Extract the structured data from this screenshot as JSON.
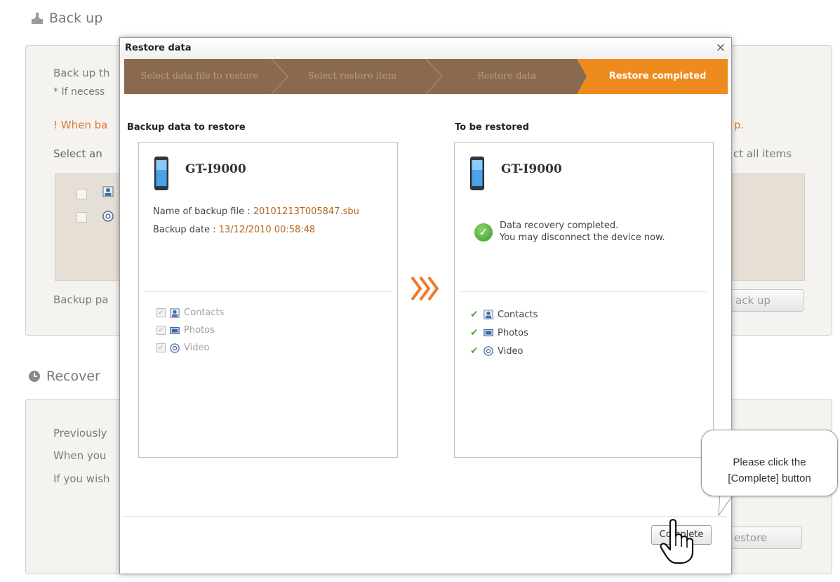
{
  "background": {
    "backup": {
      "title": "Back up",
      "lines": [
        "Back up th",
        "* If necess"
      ],
      "warning": "! When ba",
      "warning_tail": "p.",
      "select_label": "Select an",
      "select_all_tail": "ct all items",
      "path_label": "Backup pa",
      "button": "ack up"
    },
    "recover": {
      "title": "Recover",
      "lines": [
        "Previously",
        "When you",
        "If you wish"
      ],
      "button": "estore"
    }
  },
  "dialog": {
    "title": "Restore data",
    "close": "×",
    "steps": [
      "Select data file to restore",
      "Select restore item",
      "Restore data",
      "Restore completed"
    ],
    "active_step": 3,
    "left": {
      "label": "Backup data to restore",
      "model": "GT-I9000",
      "file_label": "Name of backup file : ",
      "file_value": "20101213T005847.sbu",
      "date_label": "Backup date : ",
      "date_value": "13/12/2010 00:58:48",
      "items": [
        "Contacts",
        "Photos",
        "Video"
      ]
    },
    "right": {
      "label": "To be restored",
      "model": "GT-I9000",
      "status_line1": "Data recovery completed.",
      "status_line2": "You may disconnect the device now.",
      "items": [
        "Contacts",
        "Photos",
        "Video"
      ]
    },
    "complete_button": "Complete"
  },
  "callout": {
    "line1": "Please click the",
    "line2": "[Complete] button"
  },
  "colors": {
    "step_bar": "#8a6a4e",
    "step_active": "#ee8b1f",
    "accent_orange": "#e07a2a",
    "value_brown": "#b5651d",
    "check_green": "#5aa63a"
  },
  "icons": [
    "download-icon",
    "clock-icon",
    "phone-icon",
    "contacts-icon",
    "photos-icon",
    "video-icon",
    "check-icon",
    "chevrons-icon",
    "hand-cursor-icon",
    "close-icon"
  ]
}
